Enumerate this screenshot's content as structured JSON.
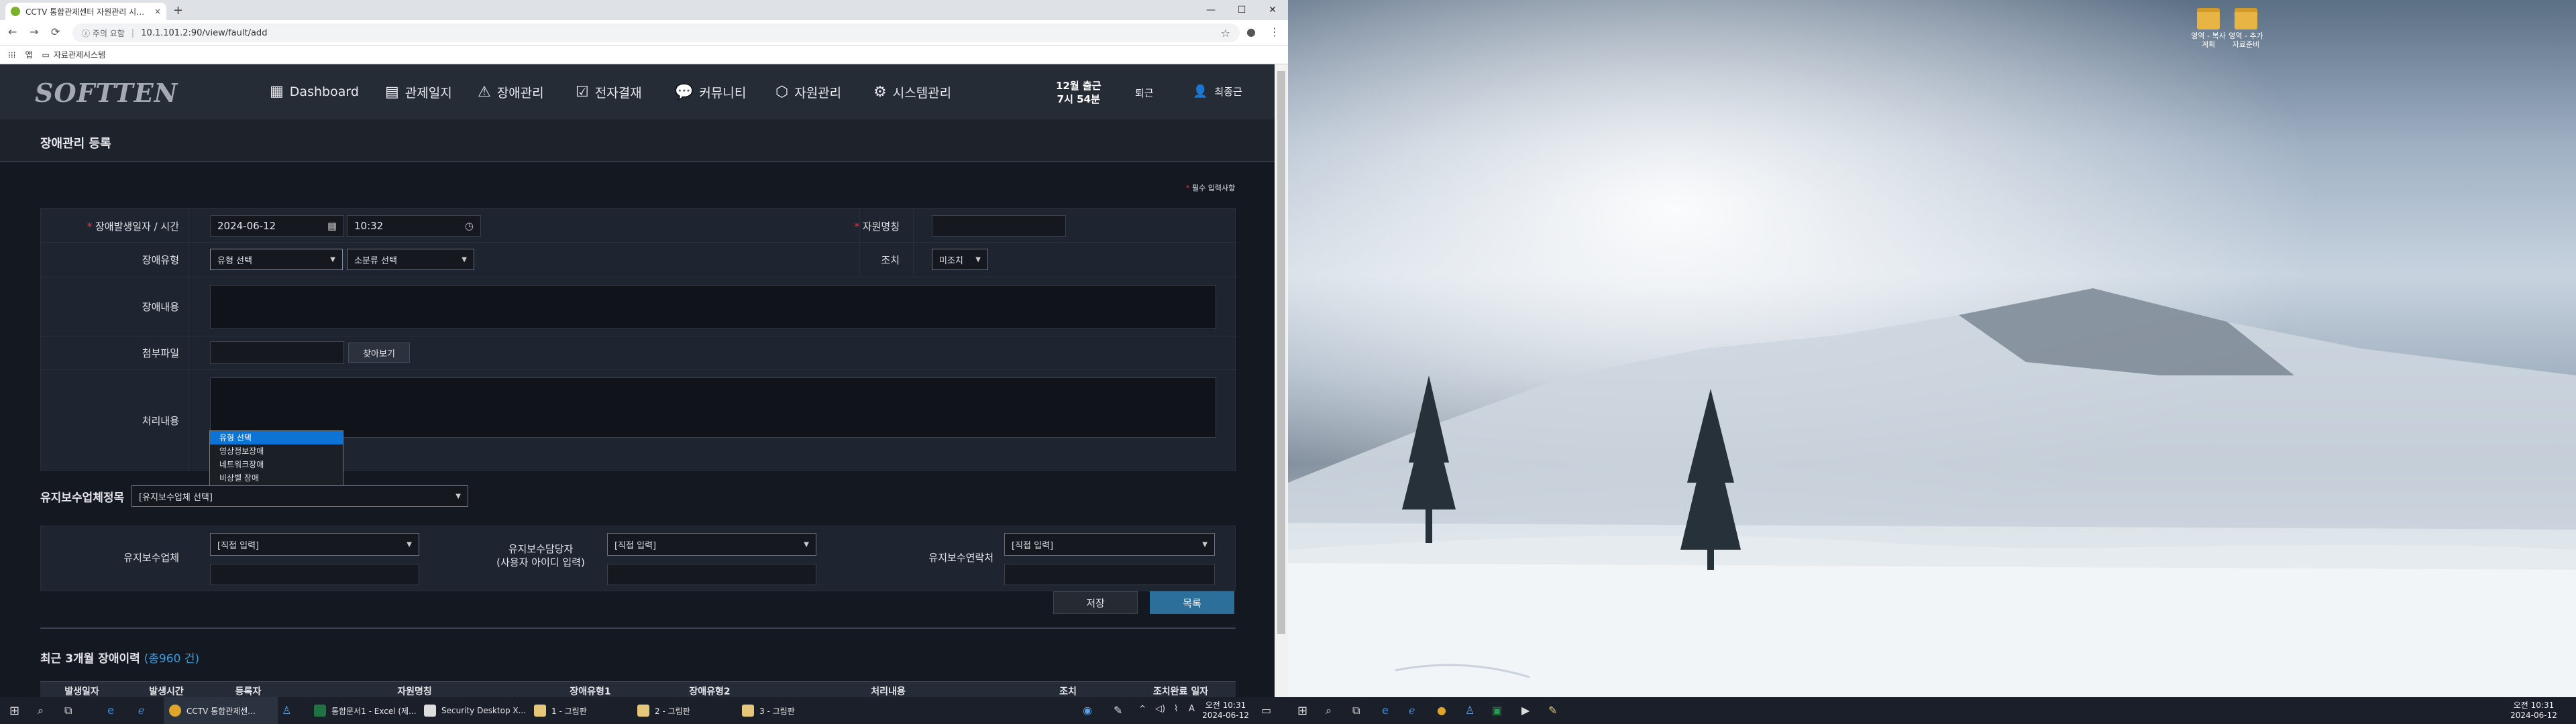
{
  "browser": {
    "tab_title": "CCTV 통합관제센터 자원관리 시스템",
    "tab_close": "×",
    "new_tab": "+",
    "window_controls": [
      "—",
      "☐",
      "✕"
    ],
    "security_warning": "ⓘ 주의 요함",
    "url": "10.1.101.2:90/view/fault/add",
    "bookmarks": [
      "앱",
      "자료관제시스템"
    ]
  },
  "app": {
    "logo": "SOFTTEN",
    "menu": [
      {
        "icon": "dashboard-icon",
        "glyph": "▦",
        "label": "Dashboard"
      },
      {
        "icon": "journal-icon",
        "glyph": "▤",
        "label": "관제일지"
      },
      {
        "icon": "warning-icon",
        "glyph": "⚠",
        "label": "장애관리"
      },
      {
        "icon": "approval-icon",
        "glyph": "☑",
        "label": "전자결재"
      },
      {
        "icon": "community-icon",
        "glyph": "💬",
        "label": "커뮤니티"
      },
      {
        "icon": "resource-icon",
        "glyph": "⬡",
        "label": "자원관리"
      },
      {
        "icon": "settings-icon",
        "glyph": "⚙",
        "label": "시스템관리"
      }
    ],
    "clock_date": "12월 출근",
    "clock_time": "7시 54분",
    "logout": "퇴근",
    "user_name": "최종근"
  },
  "page": {
    "title": "장애관리 등록",
    "required_note": "필수 입력사항"
  },
  "form": {
    "occur_label": "장애발생일자 / 시간",
    "date_value": "2024-06-12",
    "time_value": "10:32",
    "resource_label": "자원명칭",
    "type_label": "장애유형",
    "type_selected": "유형 선택",
    "subtype_selected": "소분류 선택",
    "action_label": "조치",
    "action_selected": "미조치",
    "content_label": "장애내용",
    "attach_label": "첨부파일",
    "browse_button": "찾아보기",
    "process_label": "처리내용",
    "type_options": [
      "유형 선택",
      "영상정보장애",
      "네트워크장애",
      "비상벨 장애"
    ]
  },
  "maintenance": {
    "section_title": "유지보수업체정목",
    "company_select": "[유지보수업체 선택]",
    "company_label": "유지보수업체",
    "company_input": "[직접 입력]",
    "manager_label_1": "유지보수담당자",
    "manager_label_2": "(사용자 아이디 입력)",
    "manager_input": "[직접 입력]",
    "contact_label": "유지보수연락처",
    "contact_input": "[직접 입력]"
  },
  "buttons": {
    "save": "저장",
    "list": "목록"
  },
  "recent": {
    "title": "최근 3개월 장애이력",
    "total": "(총960 건)",
    "columns": [
      "발생일자",
      "발생시간",
      "등록자",
      "자원명칭",
      "장애유형1",
      "장애유형2",
      "처리내용",
      "조치",
      "조치완료 일자"
    ]
  },
  "taskbar_left": {
    "items": [
      "CCTV 통합관제센...",
      "통합문서1 - Excel (제...",
      "Security Desktop X...",
      "1 - 그림판",
      "2 - 그림판",
      "3 - 그림판"
    ],
    "clock_time": "오전 10:31",
    "clock_date": "2024-06-12"
  },
  "desktop": {
    "icons": [
      "영역 - 복사 계획",
      "영역 - 추가 자료준비"
    ]
  },
  "taskbar_right": {
    "clock_time": "오전 10:31",
    "clock_date": "2024-06-12"
  },
  "colors": {
    "accent": "#2d6f9b",
    "required": "#e33333",
    "highlight": "#0d74d6"
  }
}
